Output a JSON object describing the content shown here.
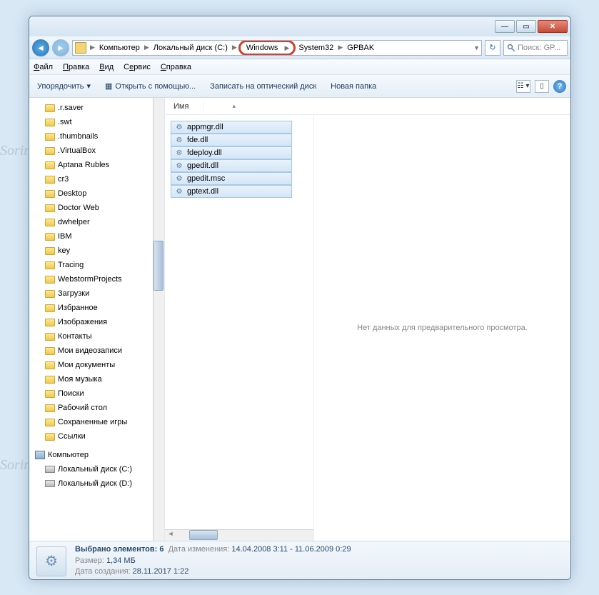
{
  "breadcrumb": {
    "segments": [
      "Компьютер",
      "Локальный диск (C:)",
      "Windows",
      "System32",
      "GPBAK"
    ],
    "highlighted_index": 2
  },
  "search": {
    "placeholder": "Поиск: GP..."
  },
  "menu": {
    "file": "Файл",
    "edit": "Правка",
    "view": "Вид",
    "tools": "Сервис",
    "help": "Справка"
  },
  "toolbar": {
    "organize": "Упорядочить",
    "open_with": "Открыть с помощью...",
    "burn": "Записать на оптический диск",
    "new_folder": "Новая папка"
  },
  "columns": {
    "name": "Имя"
  },
  "sidebar": {
    "items": [
      ".r.saver",
      ".swt",
      ".thumbnails",
      ".VirtualBox",
      "Aptana Rubles",
      "cr3",
      "Desktop",
      "Doctor Web",
      "dwhelper",
      "IBM",
      "key",
      "Tracing",
      "WebstormProjects",
      "Загрузки",
      "Избранное",
      "Изображения",
      "Контакты",
      "Мои видеозаписи",
      "Мои документы",
      "Моя музыка",
      "Поиски",
      "Рабочий стол",
      "Сохраненные игры",
      "Ссылки"
    ],
    "computer": "Компьютер",
    "drives": [
      "Локальный диск (C:)",
      "Локальный диск (D:)"
    ]
  },
  "files": [
    "appmgr.dll",
    "fde.dll",
    "fdeploy.dll",
    "gpedit.dll",
    "gpedit.msc",
    "gptext.dll"
  ],
  "preview": {
    "empty": "Нет данных для предварительного просмотра."
  },
  "status": {
    "selected_label": "Выбрано элементов: 6",
    "modified_label": "Дата изменения:",
    "modified_value": "14.04.2008 3:11 - 11.06.2009 0:29",
    "size_label": "Размер:",
    "size_value": "1,34 МБ",
    "created_label": "Дата создания:",
    "created_value": "28.11.2017 1:22"
  },
  "watermark": "Soringperepair.Com"
}
